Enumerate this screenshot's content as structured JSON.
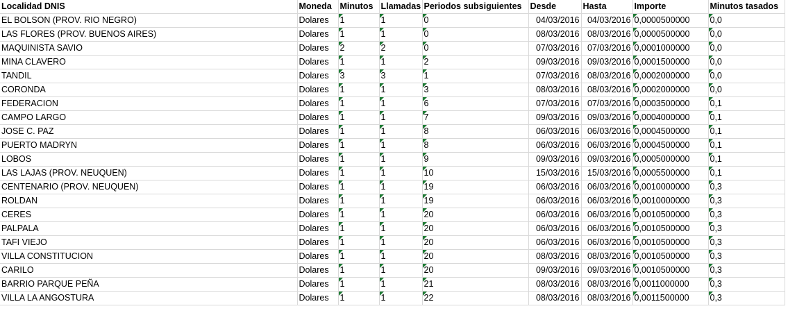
{
  "headers": [
    "Localidad DNIS",
    "Moneda",
    "Minutos",
    "Llamadas",
    "Periodos subsiguientes",
    "Desde",
    "Hasta",
    "Importe",
    "Minutos tasados"
  ],
  "rows": [
    [
      "EL BOLSON (PROV. RIO NEGRO)",
      "Dolares",
      "1",
      "1",
      "0",
      "04/03/2016",
      "04/03/2016",
      "0,0000500000",
      "0,0"
    ],
    [
      "LAS FLORES (PROV.  BUENOS AIRES)",
      "Dolares",
      "1",
      "1",
      "0",
      "08/03/2016",
      "08/03/2016",
      "0,0000500000",
      "0,0"
    ],
    [
      "MAQUINISTA SAVIO",
      "Dolares",
      "2",
      "2",
      "0",
      "07/03/2016",
      "07/03/2016",
      "0,0001000000",
      "0,0"
    ],
    [
      "MINA CLAVERO",
      "Dolares",
      "1",
      "1",
      "2",
      "09/03/2016",
      "09/03/2016",
      "0,0001500000",
      "0,0"
    ],
    [
      "TANDIL",
      "Dolares",
      "3",
      "3",
      "1",
      "07/03/2016",
      "08/03/2016",
      "0,0002000000",
      "0,0"
    ],
    [
      "CORONDA",
      "Dolares",
      "1",
      "1",
      "3",
      "08/03/2016",
      "08/03/2016",
      "0,0002000000",
      "0,0"
    ],
    [
      "FEDERACION",
      "Dolares",
      "1",
      "1",
      "6",
      "07/03/2016",
      "07/03/2016",
      "0,0003500000",
      "0,1"
    ],
    [
      "CAMPO LARGO",
      "Dolares",
      "1",
      "1",
      "7",
      "09/03/2016",
      "09/03/2016",
      "0,0004000000",
      "0,1"
    ],
    [
      "JOSE C. PAZ",
      "Dolares",
      "1",
      "1",
      "8",
      "06/03/2016",
      "06/03/2016",
      "0,0004500000",
      "0,1"
    ],
    [
      "PUERTO MADRYN",
      "Dolares",
      "1",
      "1",
      "8",
      "06/03/2016",
      "06/03/2016",
      "0,0004500000",
      "0,1"
    ],
    [
      "LOBOS",
      "Dolares",
      "1",
      "1",
      "9",
      "09/03/2016",
      "09/03/2016",
      "0,0005000000",
      "0,1"
    ],
    [
      "LAS LAJAS (PROV. NEUQUEN)",
      "Dolares",
      "1",
      "1",
      "10",
      "15/03/2016",
      "15/03/2016",
      "0,0005500000",
      "0,1"
    ],
    [
      "CENTENARIO (PROV.  NEUQUEN)",
      "Dolares",
      "1",
      "1",
      "19",
      "06/03/2016",
      "06/03/2016",
      "0,0010000000",
      "0,3"
    ],
    [
      "ROLDAN",
      "Dolares",
      "1",
      "1",
      "19",
      "06/03/2016",
      "06/03/2016",
      "0,0010000000",
      "0,3"
    ],
    [
      "CERES",
      "Dolares",
      "1",
      "1",
      "20",
      "06/03/2016",
      "06/03/2016",
      "0,0010500000",
      "0,3"
    ],
    [
      "PALPALA",
      "Dolares",
      "1",
      "1",
      "20",
      "06/03/2016",
      "06/03/2016",
      "0,0010500000",
      "0,3"
    ],
    [
      "TAFI VIEJO",
      "Dolares",
      "1",
      "1",
      "20",
      "06/03/2016",
      "06/03/2016",
      "0,0010500000",
      "0,3"
    ],
    [
      "VILLA CONSTITUCION",
      "Dolares",
      "1",
      "1",
      "20",
      "08/03/2016",
      "08/03/2016",
      "0,0010500000",
      "0,3"
    ],
    [
      "CARILO",
      "Dolares",
      "1",
      "1",
      "20",
      "09/03/2016",
      "09/03/2016",
      "0,0010500000",
      "0,3"
    ],
    [
      "BARRIO PARQUE PEÑA",
      "Dolares",
      "1",
      "1",
      "21",
      "08/03/2016",
      "08/03/2016",
      "0,0011000000",
      "0,3"
    ],
    [
      "VILLA LA ANGOSTURA",
      "Dolares",
      "1",
      "1",
      "22",
      "08/03/2016",
      "08/03/2016",
      "0,0011500000",
      "0,3"
    ]
  ],
  "colors": {
    "gridline": "#d9d9d9",
    "text_stored_as_number_flag": "#1e7b34"
  }
}
